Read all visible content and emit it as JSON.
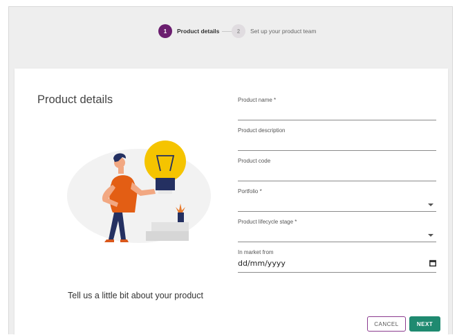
{
  "stepper": {
    "steps": [
      {
        "number": "1",
        "label": "Product details"
      },
      {
        "number": "2",
        "label": "Set up your product team"
      }
    ]
  },
  "main": {
    "title": "Product details",
    "tagline": "Tell us a little bit about your product"
  },
  "form": {
    "product_name": {
      "label": "Product name *"
    },
    "product_description": {
      "label": "Product description"
    },
    "product_code": {
      "label": "Product code"
    },
    "portfolio": {
      "label": "Portfolio *"
    },
    "lifecycle_stage": {
      "label": "Product lifecycle stage *"
    },
    "in_market_from": {
      "label": "In market from",
      "placeholder": "dd/mm/yyyy"
    }
  },
  "actions": {
    "cancel_label": "CANCEL",
    "next_label": "NEXT"
  },
  "colors": {
    "accent_purple": "#6b1e6f",
    "primary_green": "#1f8a70",
    "bulb_yellow": "#f5c400"
  },
  "icons": {
    "illustration": "person-holding-lightbulb",
    "date_picker": "calendar-icon",
    "dropdown": "chevron-down-icon"
  }
}
